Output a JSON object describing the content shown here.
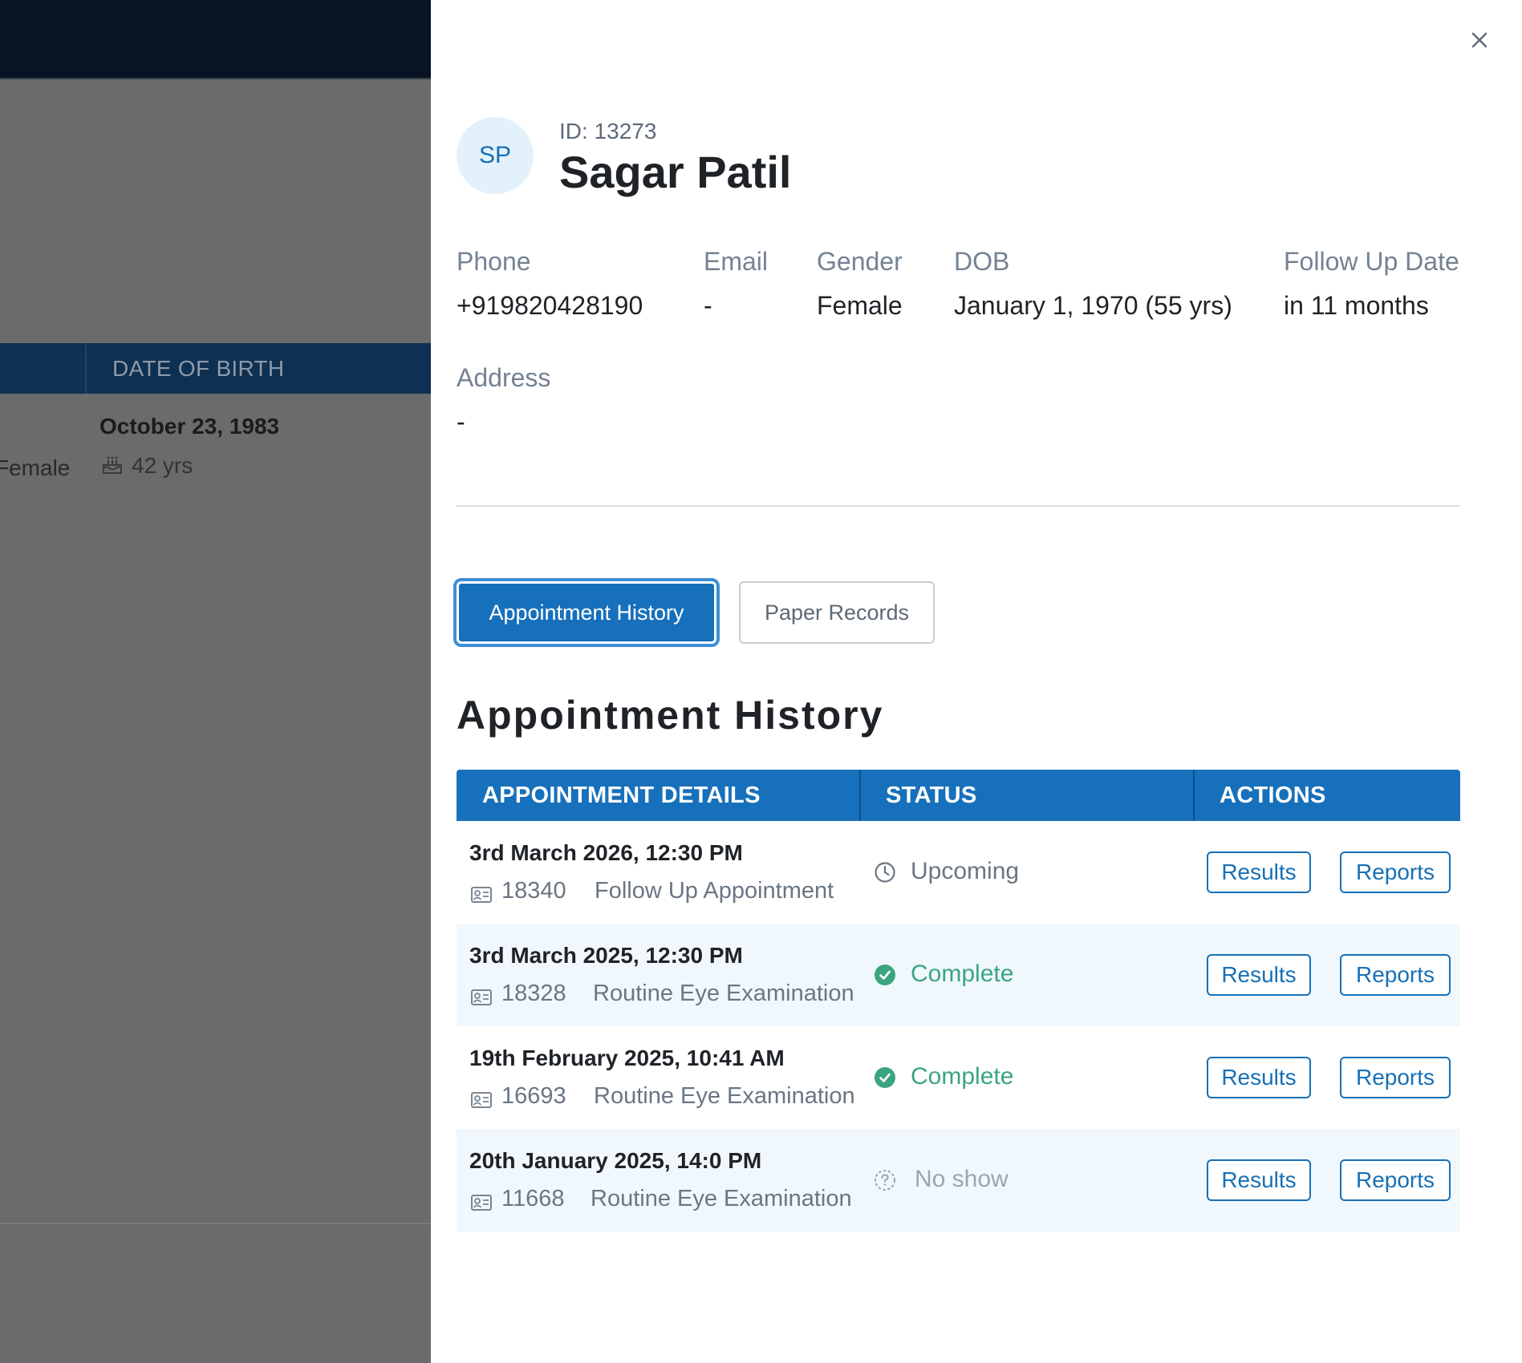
{
  "background": {
    "column_header": "DATE OF BIRTH",
    "row": {
      "dob": "October 23, 1983",
      "gender": "Female",
      "age": "42 yrs"
    }
  },
  "patient": {
    "initials": "SP",
    "id_label": "ID: 13273",
    "name": "Sagar Patil"
  },
  "fields": {
    "phone": {
      "label": "Phone",
      "value": "+919820428190"
    },
    "email": {
      "label": "Email",
      "value": "-"
    },
    "gender": {
      "label": "Gender",
      "value": "Female"
    },
    "dob": {
      "label": "DOB",
      "value": "January 1, 1970 (55 yrs)"
    },
    "follow_up": {
      "label": "Follow Up Date",
      "value": "in 11 months"
    },
    "address": {
      "label": "Address",
      "value": "-"
    }
  },
  "tabs": {
    "active": "Appointment History",
    "inactive": "Paper Records"
  },
  "section_title": "Appointment History",
  "table": {
    "headers": [
      "APPOINTMENT DETAILS",
      "STATUS",
      "ACTIONS"
    ],
    "rows": [
      {
        "date": "3rd March 2026, 12:30 PM",
        "number": "18340",
        "type": "Follow Up Appointment",
        "status": "Upcoming",
        "results": "Results",
        "reports": "Reports"
      },
      {
        "date": "3rd March 2025, 12:30 PM",
        "number": "18328",
        "type": "Routine Eye Examination",
        "status": "Complete",
        "results": "Results",
        "reports": "Reports"
      },
      {
        "date": "19th February 2025, 10:41 AM",
        "number": "16693",
        "type": "Routine Eye Examination",
        "status": "Complete",
        "results": "Results",
        "reports": "Reports"
      },
      {
        "date": "20th January 2025, 14:0 PM",
        "number": "11668",
        "type": "Routine Eye Examination",
        "status": "No show",
        "results": "Results",
        "reports": "Reports"
      }
    ]
  },
  "colors": {
    "primary": "#1770bb",
    "complete": "#3aa57f",
    "upcoming": "#6a7683",
    "no_show": "#9aa5b1",
    "row_alt": "#f1f8fd"
  },
  "icons": {
    "close": "close-icon",
    "id_card": "id-card-icon",
    "clock": "clock-icon",
    "check": "check-circle-icon",
    "question": "question-circle-icon",
    "cake": "cake-icon"
  }
}
